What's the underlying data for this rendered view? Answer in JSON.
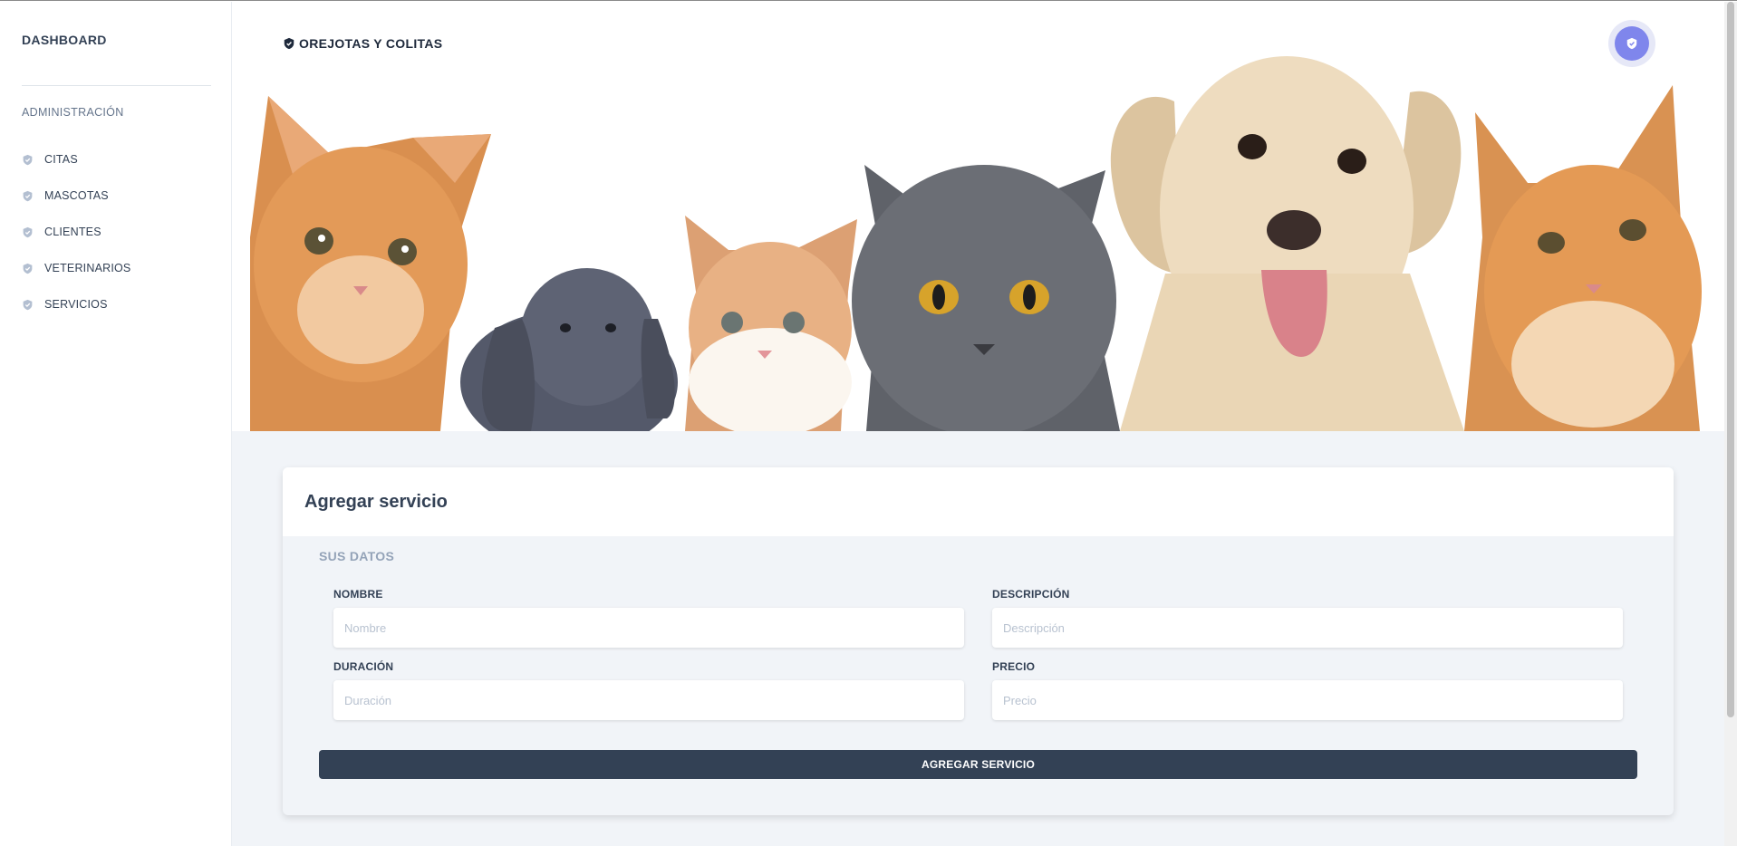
{
  "sidebar": {
    "brand": "DASHBOARD",
    "section_heading": "ADMINISTRACIÓN",
    "items": [
      {
        "label": "CITAS",
        "icon": "shield-icon"
      },
      {
        "label": "MASCOTAS",
        "icon": "shield-icon"
      },
      {
        "label": "CLIENTES",
        "icon": "shield-icon"
      },
      {
        "label": "VETERINARIOS",
        "icon": "shield-icon"
      },
      {
        "label": "SERVICIOS",
        "icon": "shield-icon"
      }
    ]
  },
  "topbar": {
    "title": "OREJOTAS Y COLITAS",
    "title_icon": "shield-icon",
    "avatar_icon": "user-avatar-icon"
  },
  "hero": {
    "image": "banner of cats, rabbit and dog"
  },
  "form": {
    "title": "Agregar servicio",
    "section": "SUS DATOS",
    "fields": [
      {
        "label": "NOMBRE",
        "placeholder": "Nombre",
        "value": ""
      },
      {
        "label": "DESCRIPCIÓN",
        "placeholder": "Descripción",
        "value": ""
      },
      {
        "label": "DURACIÓN",
        "placeholder": "Duración",
        "value": ""
      },
      {
        "label": "PRECIO",
        "placeholder": "Precio",
        "value": ""
      }
    ],
    "submit_label": "AGREGAR SERVICIO"
  },
  "colors": {
    "primary": "#334155",
    "sidebar_icon": "#a9b4c6",
    "avatar": "#7f86ec",
    "background": "#f1f4f8"
  }
}
